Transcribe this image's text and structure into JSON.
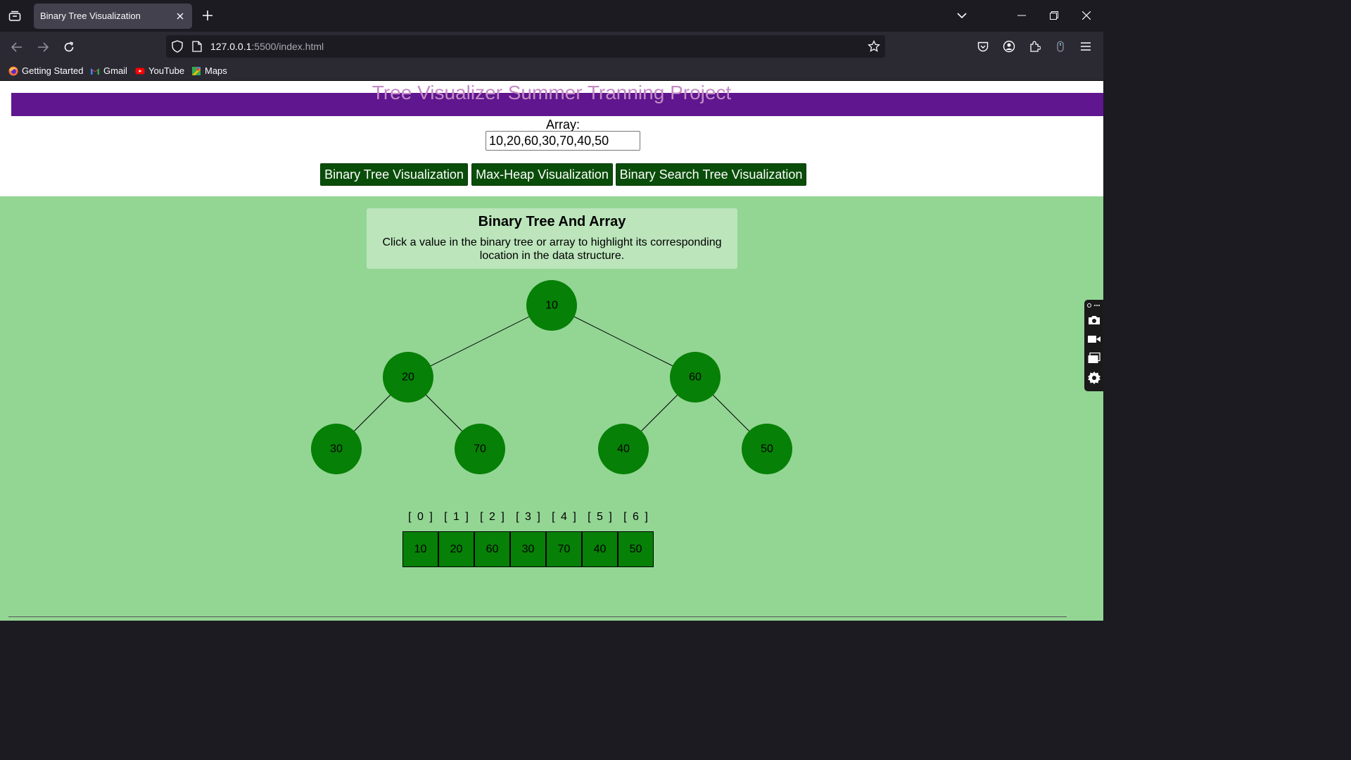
{
  "browser": {
    "tab_title": "Binary Tree Visualization",
    "url_host": "127.0.0.1",
    "url_rest": ":5500/index.html",
    "bookmarks": [
      {
        "label": "Getting Started",
        "icon": "firefox-icon"
      },
      {
        "label": "Gmail",
        "icon": "gmail-icon"
      },
      {
        "label": "YouTube",
        "icon": "youtube-icon"
      },
      {
        "label": "Maps",
        "icon": "maps-icon"
      }
    ]
  },
  "page": {
    "banner_title": "Tree Visualizer Summer Tranning Project",
    "array_label": "Array:",
    "array_value": "10,20,60,30,70,40,50",
    "buttons": {
      "binary_tree": "Binary Tree Visualization",
      "max_heap": "Max-Heap Visualization",
      "bst": "Binary Search Tree Visualization"
    },
    "info": {
      "title": "Binary Tree And Array",
      "text": "Click a value in the binary tree or array to highlight its corresponding location in the data structure."
    },
    "tree_nodes": [
      "10",
      "20",
      "60",
      "30",
      "70",
      "40",
      "50"
    ],
    "array_indices": [
      "[ 0 ]",
      "[ 1 ]",
      "[ 2 ]",
      "[ 3 ]",
      "[ 4 ]",
      "[ 5 ]",
      "[ 6 ]"
    ],
    "array_values": [
      "10",
      "20",
      "60",
      "30",
      "70",
      "40",
      "50"
    ]
  },
  "colors": {
    "banner_bg": "#5f168f",
    "banner_text": "#c48bc4",
    "button_bg": "#0a4d0a",
    "viz_bg": "#93d694",
    "node_fill": "#068006",
    "info_bg": "#bce5bc"
  }
}
